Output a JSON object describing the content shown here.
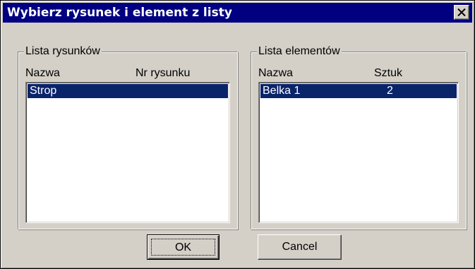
{
  "window": {
    "title": "Wybierz rysunek i element z listy",
    "close_icon": "close-icon"
  },
  "drawings": {
    "group_label": "Lista rysunków",
    "columns": [
      "Nazwa",
      "Nr rysunku"
    ],
    "rows": [
      {
        "name": "Strop",
        "number": "",
        "selected": true
      }
    ]
  },
  "elements": {
    "group_label": "Lista elementów",
    "columns": [
      "Nazwa",
      "Sztuk"
    ],
    "rows": [
      {
        "name": "Belka 1",
        "count": "2",
        "selected": true
      }
    ]
  },
  "buttons": {
    "ok_label": "OK",
    "cancel_label": "Cancel"
  },
  "colors": {
    "title_bar": "#000080",
    "selection": "#0a246a",
    "face": "#d4d0c8"
  }
}
